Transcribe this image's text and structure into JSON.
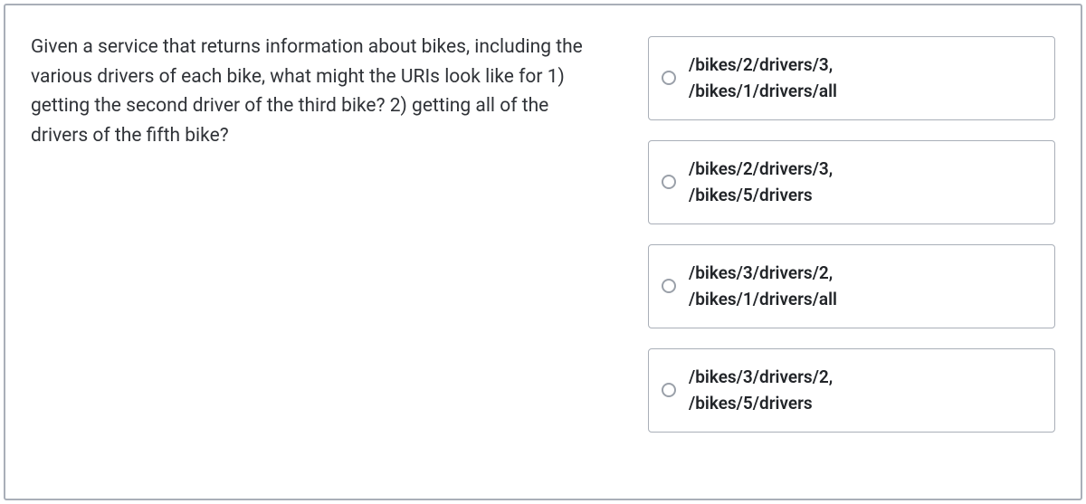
{
  "question": {
    "text": "Given a service that returns information about bikes, including the various drivers of each bike, what might the URIs look like for 1) getting the second driver of the third bike? 2) getting all of the drivers of the fifth bike?"
  },
  "answers": [
    {
      "line1": "/bikes/2/drivers/3,",
      "line2": "/bikes/1/drivers/all"
    },
    {
      "line1": "/bikes/2/drivers/3,",
      "line2": "/bikes/5/drivers"
    },
    {
      "line1": "/bikes/3/drivers/2,",
      "line2": "/bikes/1/drivers/all"
    },
    {
      "line1": "/bikes/3/drivers/2,",
      "line2": "/bikes/5/drivers"
    }
  ]
}
